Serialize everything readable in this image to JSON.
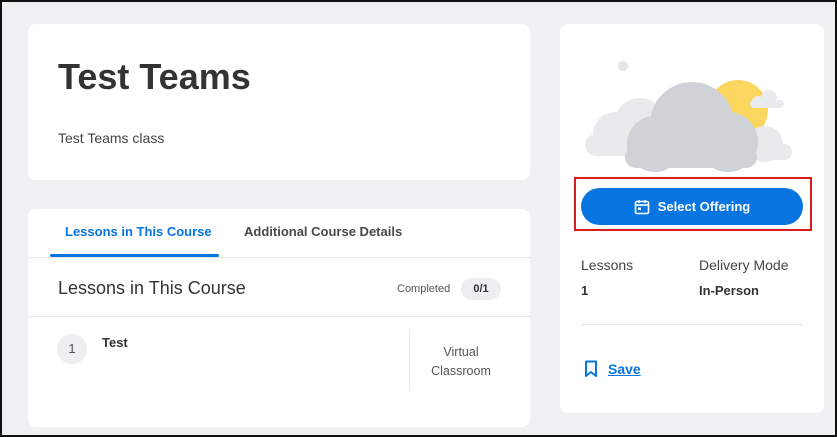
{
  "course": {
    "title": "Test Teams",
    "description": "Test Teams class"
  },
  "tabs": [
    {
      "label": "Lessons in This Course",
      "active": true
    },
    {
      "label": "Additional Course Details",
      "active": false
    }
  ],
  "lessons_section": {
    "title": "Lessons in This Course",
    "completed_label": "Completed",
    "completed_count": "0/1",
    "items": [
      {
        "number": "1",
        "name": "Test",
        "type_line1": "Virtual",
        "type_line2": "Classroom"
      }
    ]
  },
  "offering": {
    "illustration": "cloud-sun-icon",
    "button_icon": "calendar-icon",
    "button_label": "Select Offering",
    "lessons_label": "Lessons",
    "lessons_value": "1",
    "delivery_label": "Delivery Mode",
    "delivery_value": "In-Person",
    "save_icon": "bookmark-icon",
    "save_label": "Save"
  },
  "colors": {
    "accent": "#0875e1",
    "highlight": "#d81c1c",
    "background": "#f0f1f2"
  }
}
